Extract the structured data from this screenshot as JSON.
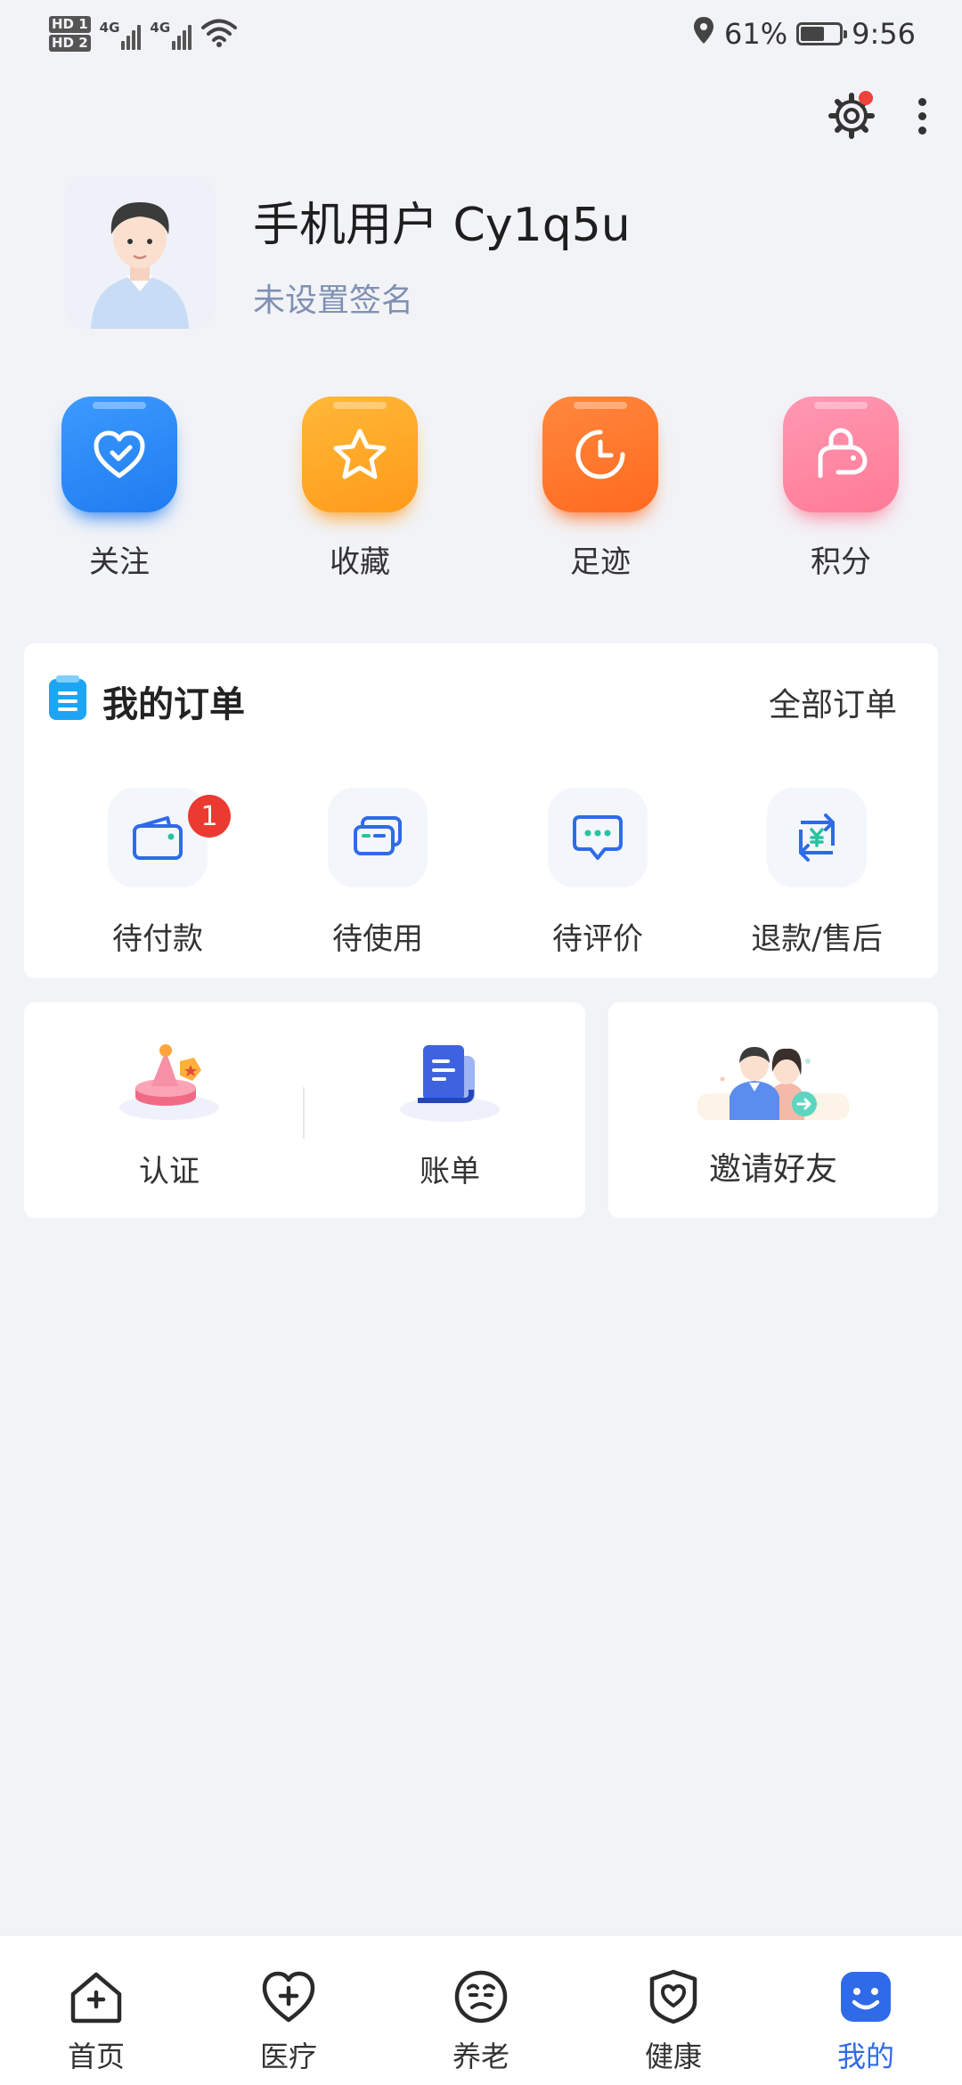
{
  "status_bar": {
    "hd1": "HD 1",
    "hd2": "HD 2",
    "net1": "4G",
    "net2": "4G",
    "battery_percent": "61%",
    "battery_level": 0.61,
    "time": "9:56"
  },
  "header": {
    "settings_has_dot": true,
    "colors": {
      "dot": "#f0413c"
    }
  },
  "profile": {
    "name": "手机用户 Cy1q5u",
    "signature": "未设置签名"
  },
  "shortcuts": [
    {
      "label": "关注",
      "icon": "heart-check-icon",
      "color": "#1e7cf0"
    },
    {
      "label": "收藏",
      "icon": "star-icon",
      "color": "#ff9a1a"
    },
    {
      "label": "足迹",
      "icon": "clock-icon",
      "color": "#ff6a1f"
    },
    {
      "label": "积分",
      "icon": "piggy-bank-icon",
      "color": "#ff7a95"
    }
  ],
  "orders": {
    "title": "我的订单",
    "all_label": "全部订单",
    "items": [
      {
        "label": "待付款",
        "icon": "wallet-icon",
        "badge": "1"
      },
      {
        "label": "待使用",
        "icon": "cards-icon"
      },
      {
        "label": "待评价",
        "icon": "chat-bubble-icon"
      },
      {
        "label": "退款/售后",
        "icon": "refund-icon"
      }
    ]
  },
  "tools": [
    {
      "label": "认证",
      "icon": "certification-icon"
    },
    {
      "label": "账单",
      "icon": "bill-icon"
    }
  ],
  "invite": {
    "label": "邀请好友",
    "icon": "invite-friends-icon"
  },
  "bottom_nav": {
    "active": "我的",
    "active_color": "#2f6be8",
    "items": [
      {
        "label": "首页",
        "icon": "home-icon"
      },
      {
        "label": "医疗",
        "icon": "medical-heart-icon"
      },
      {
        "label": "养老",
        "icon": "elderly-face-icon"
      },
      {
        "label": "健康",
        "icon": "health-shield-icon"
      },
      {
        "label": "我的",
        "icon": "smile-icon"
      }
    ]
  }
}
